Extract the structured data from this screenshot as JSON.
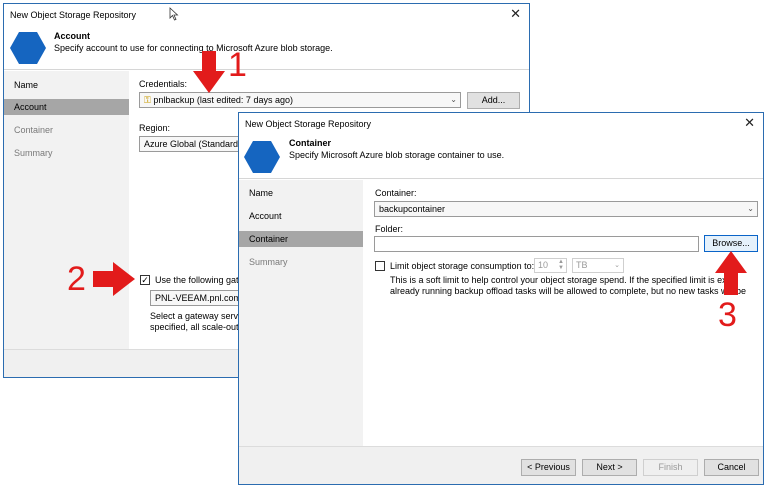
{
  "dialog_back": {
    "title": "New Object Storage Repository",
    "close": "✕",
    "header_title": "Account",
    "header_desc": "Specify account to use for connecting to Microsoft Azure blob storage.",
    "nav": [
      "Name",
      "Account",
      "Container",
      "Summary"
    ],
    "credentials_label": "Credentials:",
    "credentials_value": "pnlbackup (last edited: 7 days ago)",
    "add_button": "Add...",
    "region_label": "Region:",
    "region_value": "Azure Global (Standard)",
    "gateway_checkbox_label": "Use the following gatew",
    "gateway_value": "PNL-VEEAM.pnl.com (",
    "gateway_note_line1": "Select a gateway server",
    "gateway_note_line2": "specified, all scale-out b"
  },
  "dialog_front": {
    "title": "New Object Storage Repository",
    "close": "✕",
    "header_title": "Container",
    "header_desc": "Specify Microsoft Azure blob storage container to use.",
    "nav": [
      "Name",
      "Account",
      "Container",
      "Summary"
    ],
    "container_label": "Container:",
    "container_value": "backupcontainer",
    "folder_label": "Folder:",
    "folder_value": "",
    "browse_button": "Browse...",
    "limit_label": "Limit object storage consumption to:",
    "limit_value": "10",
    "limit_unit": "TB",
    "limit_note_line1": "This is a soft limit to help control your object storage spend. If the specified limit is exce",
    "limit_note_line2": "already running backup offload tasks will be allowed to complete, but no new tasks will be",
    "buttons": {
      "previous": "< Previous",
      "next": "Next >",
      "finish": "Finish",
      "cancel": "Cancel"
    }
  },
  "annotations": {
    "one": "1",
    "two": "2",
    "three": "3",
    "color": "#e21b1b"
  },
  "colors": {
    "accent": "#1565c0",
    "selected_nav": "#a6a6a6",
    "nav_bg": "#f2f2f2"
  }
}
